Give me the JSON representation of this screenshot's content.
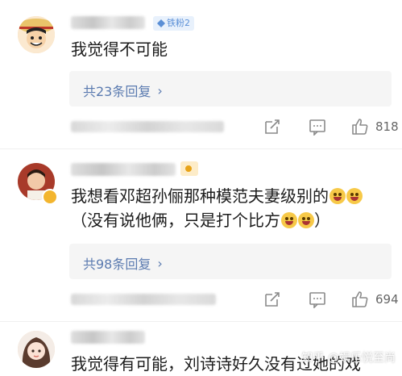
{
  "comments": [
    {
      "badge": "铁粉2",
      "text": "我觉得不可能",
      "replies_label": "共23条回复",
      "like_count": "818"
    },
    {
      "text_line1": "我想看邓超孙俪那种模范夫妻级别的",
      "text_line2": "（没有说他俩，只是打个比方",
      "text_line2_end": "）",
      "replies_label": "共98条回复",
      "like_count": "694"
    },
    {
      "text": "我觉得有可能，刘诗诗好久没有过她的戏"
    }
  ],
  "watermark": "知乎 @娱乐悦至尚"
}
